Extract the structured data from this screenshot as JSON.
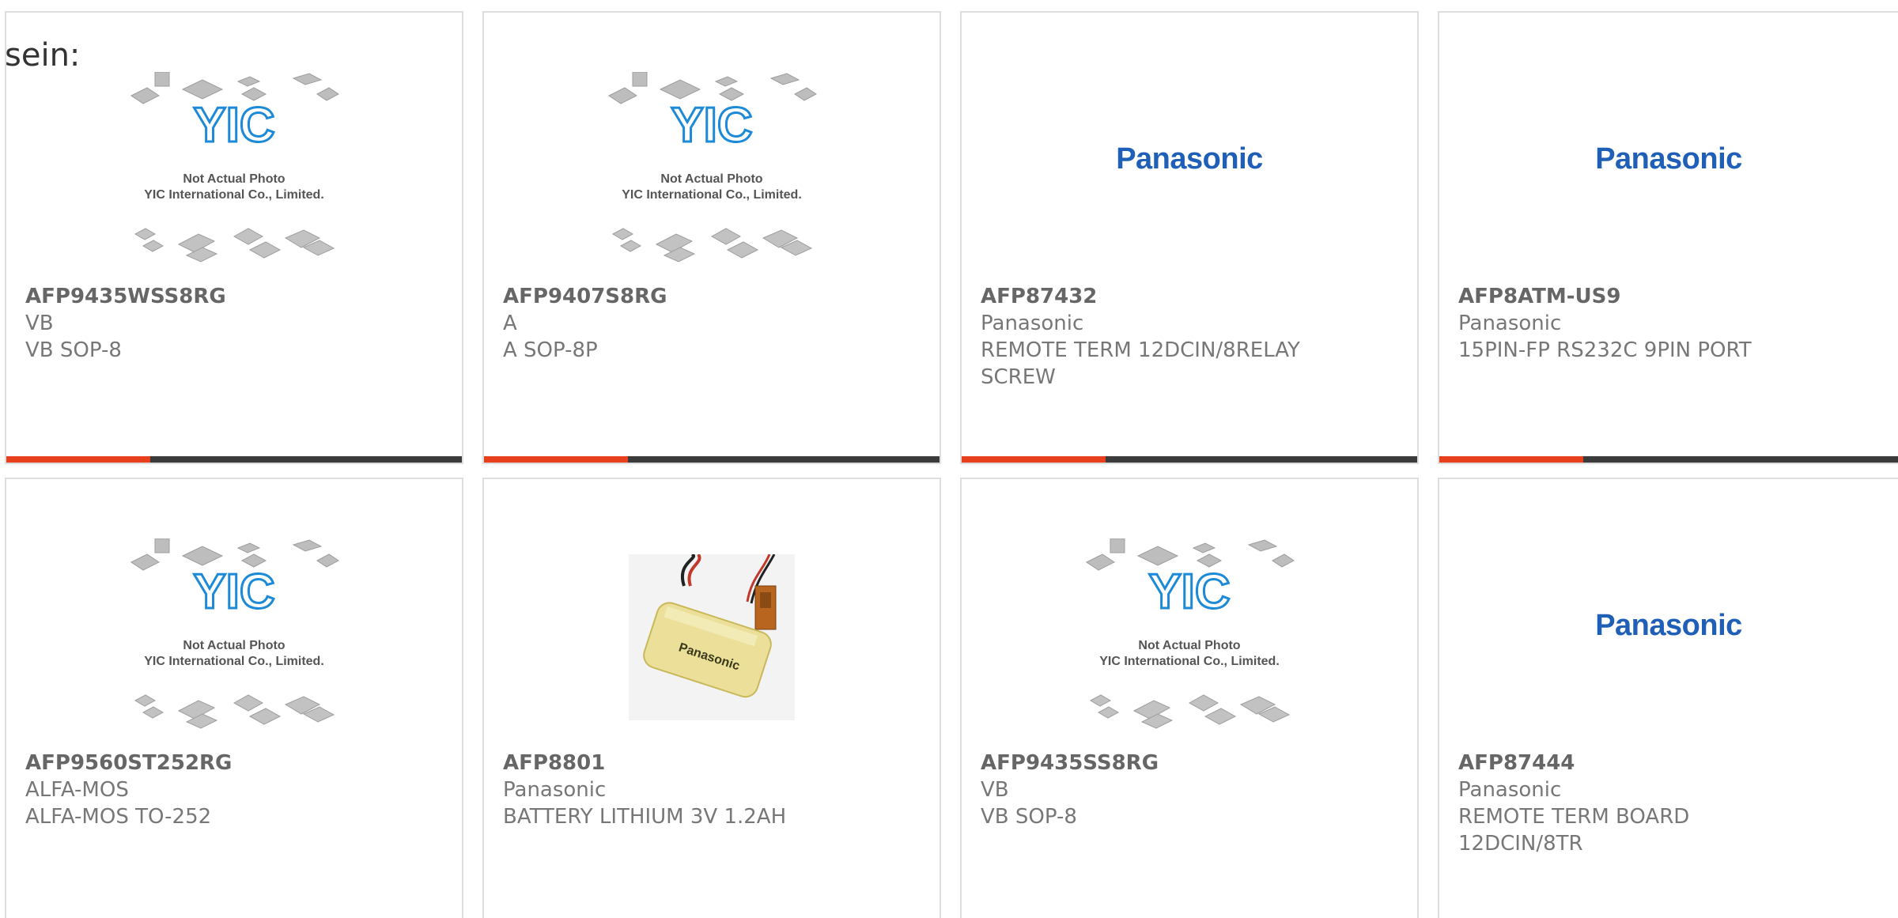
{
  "intro_text": "sein:",
  "colors": {
    "accent": "#e8401c",
    "bar": "#3b3b3b",
    "panasonic_blue": "#1f5fb7",
    "yic_blue": "#1d8ad8"
  },
  "yic_placeholder": {
    "line1": "Not Actual Photo",
    "line2": "YIC International Co., Limited.",
    "logo": "YIC"
  },
  "products": [
    {
      "part_number": "AFP9435WSS8RG",
      "manufacturer": "VB",
      "description": "VB SOP-8",
      "image": "yic-placeholder"
    },
    {
      "part_number": "AFP9407S8RG",
      "manufacturer": "A",
      "description": "A SOP-8P",
      "image": "yic-placeholder"
    },
    {
      "part_number": "AFP87432",
      "manufacturer": "Panasonic",
      "description": "REMOTE TERM 12DCIN/8RELAY SCREW",
      "image": "panasonic-logo",
      "logo_text": "Panasonic"
    },
    {
      "part_number": "AFP8ATM-US9",
      "manufacturer": "Panasonic",
      "description": "15PIN-FP RS232C 9PIN PORT",
      "image": "panasonic-logo",
      "logo_text": "Panasonic"
    },
    {
      "part_number": "AFP9560ST252RG",
      "manufacturer": "ALFA-MOS",
      "description": "ALFA-MOS TO-252",
      "image": "yic-placeholder"
    },
    {
      "part_number": "AFP8801",
      "manufacturer": "Panasonic",
      "description": "BATTERY LITHIUM 3V 1.2AH",
      "image": "battery-photo",
      "logo_text": "Panasonic"
    },
    {
      "part_number": "AFP9435SS8RG",
      "manufacturer": "VB",
      "description": "VB SOP-8",
      "image": "yic-placeholder"
    },
    {
      "part_number": "AFP87444",
      "manufacturer": "Panasonic",
      "description": "REMOTE TERM BOARD 12DCIN/8TR",
      "image": "panasonic-logo",
      "logo_text": "Panasonic"
    }
  ]
}
